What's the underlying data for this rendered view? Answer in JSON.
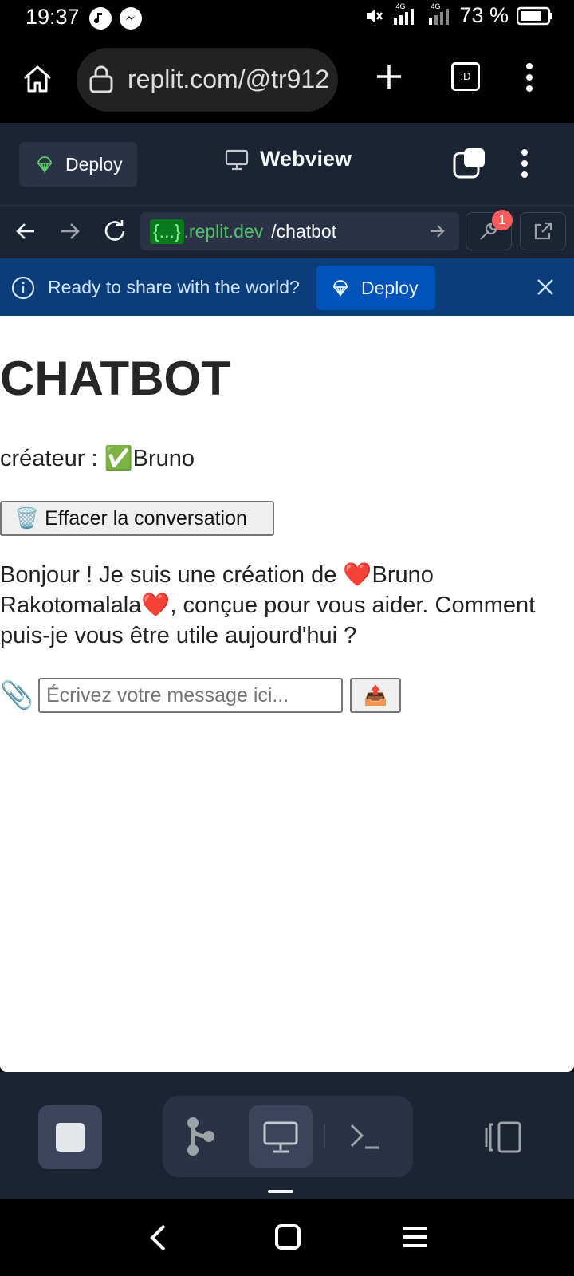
{
  "status_bar": {
    "time": "19:37",
    "battery": "73 %",
    "network_1": "4G",
    "network_2": "4G"
  },
  "browser": {
    "url": "replit.com/@tr912",
    "icons": [
      "home-icon",
      "lock-icon",
      "new-tab-icon",
      "tab-switcher-icon",
      "menu-icon"
    ],
    "tab_switcher_label": ":D"
  },
  "replit_header": {
    "deploy_label": "Deploy",
    "title": "Webview"
  },
  "replit_nav": {
    "domain_chip": "{...}",
    "domain": ".replit.dev",
    "path": "/chatbot",
    "devtools_badge": "1"
  },
  "banner": {
    "message": "Ready to share with the world?",
    "deploy_label": "Deploy"
  },
  "page": {
    "title": "CHATBOT",
    "creator": "créateur : ✅Bruno",
    "clear_button": "🗑️ Effacer la conversation",
    "bot_message": "Bonjour ! Je suis une création de ❤️Bruno Rakotomalala❤️, conçue pour vous aider. Comment puis-je vous être utile aujourd'hui ?",
    "attach_icon": "📎",
    "input_placeholder": "Écrivez votre message ici...",
    "send_icon": "📤"
  },
  "colors": {
    "replit_bg": "#1c2333",
    "banner_bg": "#0a3d7a",
    "deploy_btn": "#0053b8",
    "badge": "#ff5b5b"
  }
}
